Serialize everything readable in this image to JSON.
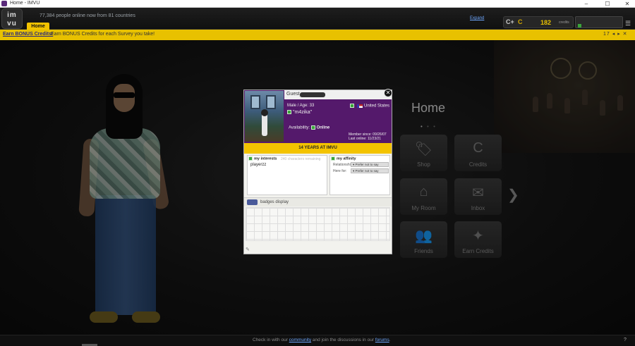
{
  "window": {
    "title": "Home - IMVU",
    "min_glyph": "–",
    "max_glyph": "☐",
    "close_glyph": "✕"
  },
  "header": {
    "logo_text": "im vu",
    "online_text": "77,384 people online now from 81 countries",
    "home_tab": "Home",
    "expand_link": "Expand",
    "credits_amount": "182",
    "credits_label": "credits",
    "credits_glyph": "C+",
    "menu_glyph": "☰"
  },
  "bonus_bar": {
    "link_text": "Earn BONUS Credits!",
    "text": "Earn BONUS Credits for each Survey you take!",
    "controls": "17 ◂ ▸ ✕"
  },
  "home_panel": {
    "title": "Home",
    "dots": [
      "•",
      "•",
      "•"
    ],
    "next_arrow": "❯",
    "tiles": [
      {
        "label": "Shop",
        "icon": "tag-icon",
        "glyph": "🏷"
      },
      {
        "label": "Credits",
        "icon": "credits-icon",
        "glyph": "C"
      },
      {
        "label": "My Room",
        "icon": "house-icon",
        "glyph": "⌂"
      },
      {
        "label": "Inbox",
        "icon": "envelope-icon",
        "glyph": "✉"
      },
      {
        "label": "Friends",
        "icon": "people-icon",
        "glyph": "👥"
      },
      {
        "label": "Earn Credits",
        "icon": "earn-credits-icon",
        "glyph": "✦"
      }
    ]
  },
  "profile": {
    "guest_prefix": "Guest_",
    "close_glyph": "✕",
    "gender_age": "Male / Age: 33",
    "country": "United States",
    "quote": "\"m4zika\"",
    "availability_label": "Availability:",
    "availability_value": "Online",
    "member_since": "Member since: 09/26/07",
    "last_online": "Last online: 11/23/21",
    "years_banner": "14 YEARS AT IMVU",
    "interests_title": "my interests",
    "interests_hint": "240 characters remaining",
    "interests_value": "playerzz",
    "affinity_title": "my affinity",
    "relationship_label": "Relationship:",
    "relationship_value": "▾ Prefer not to say",
    "here_for_label": "Here for:",
    "here_for_value": "▾ Prefer not to say",
    "badges_label": "badges display"
  },
  "footer": {
    "msg_prefix": "Check in with our",
    "community_link": "community",
    "msg_middle": "and join the discussions in our",
    "forums_link": "forums",
    "msg_suffix": ".",
    "icon_glyph": "?"
  }
}
